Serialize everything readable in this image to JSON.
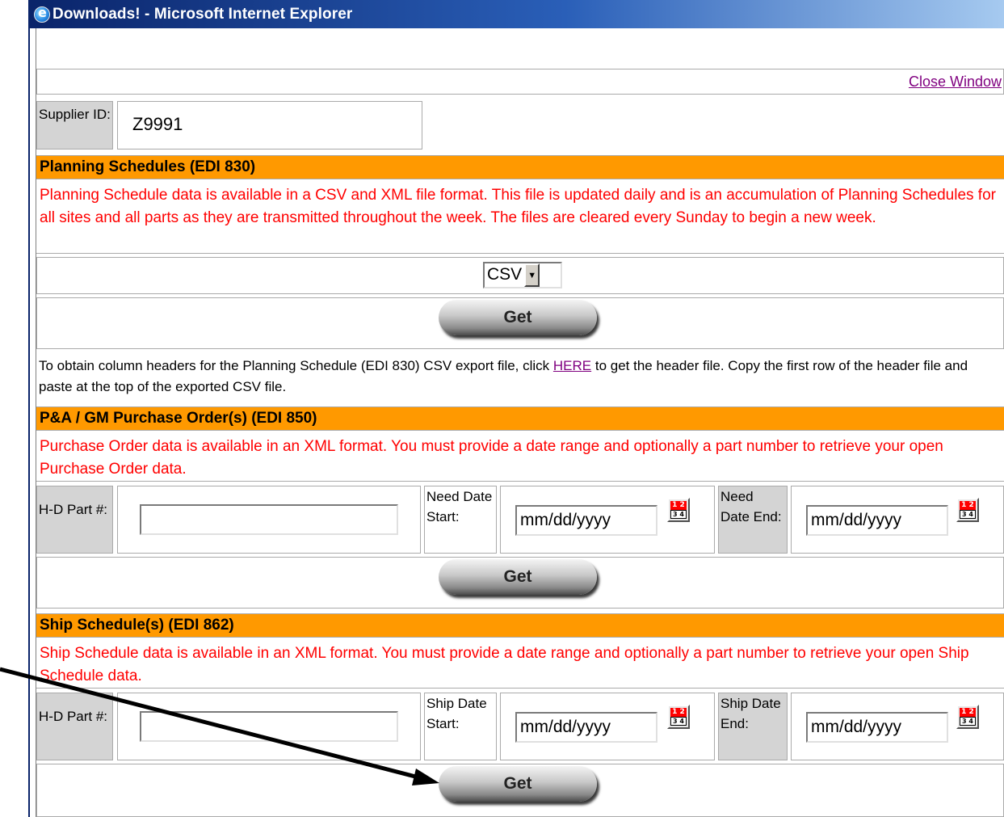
{
  "window": {
    "title": "Downloads! - Microsoft Internet Explorer"
  },
  "close_window": "Close Window",
  "supplier": {
    "label": "Supplier ID:",
    "value": "Z9991"
  },
  "planning": {
    "header": "Planning Schedules (EDI 830)",
    "description": "Planning Schedule data is available in a CSV and XML file format. This file is updated daily and is an accumulation of Planning Schedules for all sites and all parts as they are transmitted throughout the week. The files are cleared every Sunday to begin a new week.",
    "format_selected": "CSV",
    "get_label": "Get",
    "note_before": "To obtain column headers for the Planning Schedule (EDI 830) CSV export file, click ",
    "note_link": "HERE",
    "note_after": " to get the header file. Copy the first row of the header file and paste at the top of the exported CSV file."
  },
  "purchase": {
    "header": "P&A / GM Purchase Order(s) (EDI 850)",
    "description": "Purchase Order data is available in an XML format. You must provide a date range and optionally a part number to retrieve your open Purchase Order data.",
    "part_label": "H-D Part #:",
    "part_value": "",
    "start_label": "Need Date Start:",
    "start_value": "mm/dd/yyyy",
    "end_label": "Need Date End:",
    "end_value": "mm/dd/yyyy",
    "get_label": "Get"
  },
  "ship": {
    "header": "Ship Schedule(s) (EDI 862)",
    "description": "Ship Schedule data is available in an XML format. You must provide a date range and optionally a part number to retrieve your open Ship Schedule data.",
    "part_label": "H-D Part #:",
    "part_value": "",
    "start_label": "Ship Date Start:",
    "start_value": "mm/dd/yyyy",
    "end_label": "Ship Date End:",
    "end_value": "mm/dd/yyyy",
    "get_label": "Get"
  },
  "calendar_icon": {
    "name": "calendar-icon",
    "top_text": "1 2",
    "bottom_text": "3 4"
  },
  "colors": {
    "section_header": "#ff9900",
    "description_text": "#ff0000",
    "link": "#800080",
    "titlebar": "#0a246a"
  }
}
